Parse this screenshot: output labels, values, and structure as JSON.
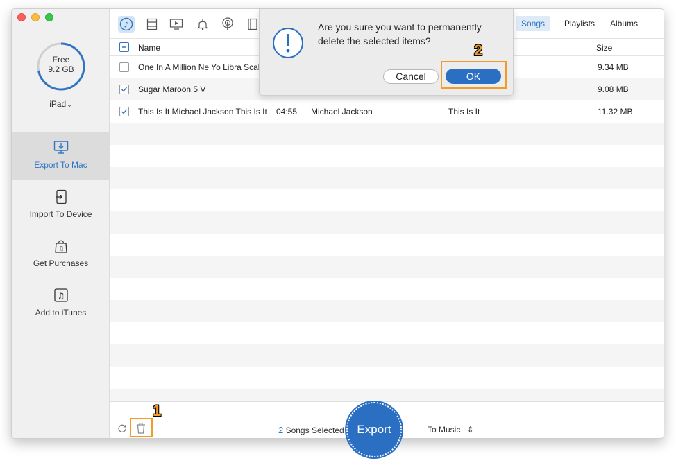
{
  "sidebar": {
    "storage": {
      "label": "Free",
      "value": "9.2 GB",
      "used_fraction": 0.28,
      "accent": "#2f74c5"
    },
    "device": "iPad",
    "items": [
      {
        "label": "Export To Mac",
        "icon": "export-to-mac-icon",
        "active": true
      },
      {
        "label": "Import To Device",
        "icon": "import-to-device-icon",
        "active": false
      },
      {
        "label": "Get Purchases",
        "icon": "get-purchases-icon",
        "active": false
      },
      {
        "label": "Add to iTunes",
        "icon": "add-to-itunes-icon",
        "active": false
      }
    ]
  },
  "toolbar": {
    "categories": [
      "music-icon",
      "movies-icon",
      "tv-icon",
      "ringtones-icon",
      "podcasts-icon",
      "audiobooks-icon"
    ],
    "tabs": [
      {
        "label": "Songs",
        "active": true
      },
      {
        "label": "Playlists",
        "active": false
      },
      {
        "label": "Albums",
        "active": false
      }
    ]
  },
  "table": {
    "headers": {
      "name": "Name",
      "size": "Size"
    },
    "rows": [
      {
        "checked": false,
        "name": "One In A Million Ne Yo Libra Scale",
        "time": "",
        "artist": "",
        "album": "",
        "size": "9.34 MB"
      },
      {
        "checked": true,
        "name": "Sugar Maroon 5 V",
        "time": "",
        "artist": "",
        "album": "",
        "size": "9.08 MB"
      },
      {
        "checked": true,
        "name": "This Is It Michael Jackson This Is It",
        "time": "04:55",
        "artist": "Michael Jackson",
        "album": "This Is It",
        "size": "11.32 MB"
      }
    ]
  },
  "footer": {
    "selected_count": "2",
    "selected_label": "Songs Selected",
    "export_label": "Export",
    "destination": "To Music"
  },
  "dialog": {
    "message": "Are you sure you want to permanently delete the selected items?",
    "cancel_label": "Cancel",
    "ok_label": "OK"
  },
  "annotations": {
    "step1": "1",
    "step2": "2",
    "highlight_color": "#f39a27"
  }
}
